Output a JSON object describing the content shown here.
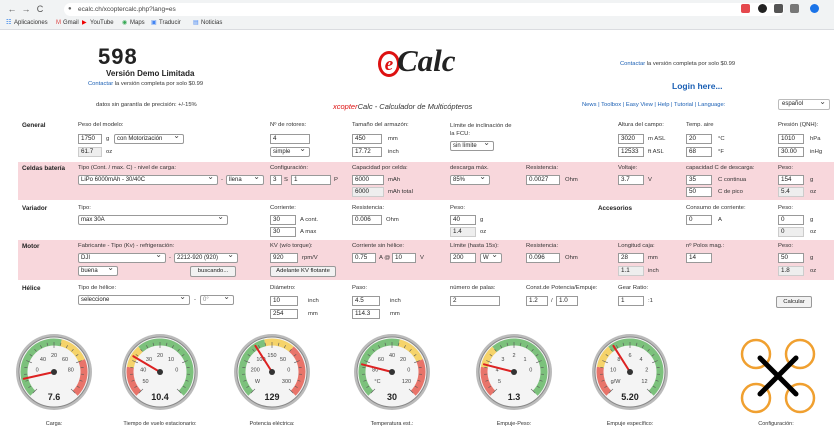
{
  "browser": {
    "url": "ecalc.ch/xcoptercalc.php?lang=es",
    "back": "←",
    "forward": "→",
    "reload": "C",
    "lock": "🔒",
    "bookmarks": [
      "Aplicaciones",
      "Gmail",
      "YouTube",
      "Maps",
      "Traducir",
      "Noticias"
    ]
  },
  "header": {
    "logo": "598",
    "version_title": "Versión Demo Limitada",
    "contact_link": "Contactar",
    "contact_rest": " la versión completa por solo $0.99",
    "no_warranty": "datos sin garantía de precisión: +/-15%",
    "ecalc_e": "e",
    "ecalc_rest": "Calc",
    "site_prefix": "xcopter",
    "site_title": "Calc - Calculador de Multicópteros",
    "full_version_link": "Contactar",
    "full_version_rest": " la versión completa por solo $0.99",
    "login": "Login here...",
    "nav": "News | Toolbox | Easy View | Help | Tutorial | Language:",
    "language": "español"
  },
  "general": {
    "label": "General",
    "model_weight_label": "Peso del modelo:",
    "model_weight": "1750",
    "g": "g",
    "weight_mode": "con Motorización",
    "oz_val": "61.7",
    "oz": "oz",
    "rotors_label": "Nº de rotores:",
    "rotors": "4",
    "frame_type": "simple",
    "frame_size_label": "Tamaño del armazón:",
    "frame_mm": "450",
    "mm": "mm",
    "frame_inch": "17.72",
    "inch": "inch",
    "fcu_limit_label": "Límite de inclinación de la FCU:",
    "fcu_limit": "sin límite",
    "field_alt_label": "Altura del campo:",
    "alt_m": "3020",
    "m_asl": "m ASL",
    "alt_ft": "12533",
    "ft_asl": "ft ASL",
    "temp_label": "Temp. aire",
    "temp_c": "20",
    "deg_c": "°C",
    "temp_f": "68",
    "deg_f": "°F",
    "pressure_label": "Presión (QNH):",
    "pressure_hpa": "1010",
    "hpa": "hPa",
    "pressure_inhg": "30.00",
    "inhg": "inHg"
  },
  "battery": {
    "label": "Celdas batería",
    "type_label": "Tipo (Cont. / max. C) - nivel de carga:",
    "type": "LiPo 6000mAh - 30/40C",
    "level": "llena",
    "config_label": "Configuración:",
    "s": "3",
    "s_unit": "S",
    "p": "1",
    "p_unit": "P",
    "capacity_label": "Capacidad por celda:",
    "cap_cell": "6000",
    "mah": "mAh",
    "cap_total": "6000",
    "mah_total": "mAh total",
    "discharge_label": "descarga máx.",
    "discharge": "85%",
    "resistance_label": "Resistencia:",
    "resistance": "0.0027",
    "ohm": "Ohm",
    "voltage_label": "Voltaje:",
    "voltage": "3.7",
    "v": "V",
    "c_rate_label": "capacidad C de descarga:",
    "c_cont": "35",
    "c_cont_unit": "C continua",
    "c_peak": "50",
    "c_peak_unit": "C de pico",
    "weight_label": "Peso:",
    "weight_g": "154",
    "weight_oz": "5.4"
  },
  "esc": {
    "label": "Variador",
    "type_label": "Tipo:",
    "type": "max 30A",
    "current_label": "Corriente:",
    "cont": "30",
    "a_cont": "A cont.",
    "max": "30",
    "a_max": "A max",
    "resistance_label": "Resistencia:",
    "resistance": "0.006",
    "ohm": "Ohm",
    "weight_label": "Peso:",
    "weight_g": "40",
    "weight_oz": "1.4",
    "accessories_label": "Accesorios",
    "acc_current_label": "Consumo de corriente:",
    "acc_current": "0",
    "a": "A",
    "acc_weight_label": "Peso:",
    "acc_weight_g": "0",
    "acc_weight_oz": "0"
  },
  "motor": {
    "label": "Motor",
    "manu_label": "Fabricante - Tipo (Kv) - refrigeración:",
    "manufacturer": "DJI",
    "type": "2212-920 (920)",
    "cooling": "buena",
    "search_btn": "buscando...",
    "kv_label": "KV (w/o torque):",
    "kv": "920",
    "rpm_v": "rpm/V",
    "kv_btn": "Adelante KV flotante",
    "no_load_label": "Corriente sin hélice:",
    "no_load": "0.75",
    "at_label": "A @",
    "no_load_v": "10",
    "v": "V",
    "limit_label": "Límite (hasta 15s):",
    "limit": "200",
    "limit_unit": "W",
    "resistance_label": "Resistencia:",
    "resistance": "0.096",
    "ohm": "Ohm",
    "case_len_label": "Longitud caja:",
    "case_mm": "28",
    "mm": "mm",
    "case_inch": "1.1",
    "inch": "inch",
    "poles_label": "nº Polos mag.:",
    "poles": "14",
    "weight_label": "Peso:",
    "weight_g": "50",
    "weight_oz": "1.8"
  },
  "propeller": {
    "label": "Hélice",
    "type_label": "Tipo de hélice:",
    "type": "seleccione",
    "angle": "0°",
    "diameter_label": "Diámetro:",
    "diam_inch": "10",
    "inch": "inch",
    "diam_mm": "254",
    "mm": "mm",
    "pitch_label": "Paso:",
    "pitch_inch": "4.5",
    "pitch_mm": "114.3",
    "blades_label": "número de palas:",
    "blades": "2",
    "const_label": "Const.de Potencia/Empuje:",
    "const_a": "1.2",
    "const_b": "1.0",
    "gear_label": "Gear Ratio:",
    "gear": "1",
    "gear_unit": ":1",
    "calc_btn": "Calcular"
  },
  "gauges": [
    {
      "caption": "Carga:",
      "value": "7.6",
      "ticks": [
        "20",
        "40",
        "60",
        "0",
        "80"
      ],
      "unit": "C",
      "needle": 0.12
    },
    {
      "caption": "Tiempo de vuelo estacionario:",
      "value": "10.4",
      "ticks": [
        "20",
        "30",
        "10",
        "40",
        "0",
        "50"
      ],
      "unit": "min",
      "needle": 0.28
    },
    {
      "caption": "Potencia eléctrica:",
      "value": "129",
      "ticks": [
        "150",
        "100",
        "50",
        "200",
        "0",
        "W",
        "300"
      ],
      "unit": "W",
      "needle": 0.38
    },
    {
      "caption": "Temperatura est.:",
      "value": "30",
      "ticks": [
        "40",
        "60",
        "20",
        "80",
        "0",
        "°C",
        "120"
      ],
      "unit": "°C",
      "needle": 0.22
    },
    {
      "caption": "Empuje-Peso:",
      "value": "1.3",
      "ticks": [
        "2",
        "3",
        "1",
        "4",
        "0",
        "5"
      ],
      "unit": "",
      "needle": 0.22
    },
    {
      "caption": "Empuje específico:",
      "value": "5.20",
      "ticks": [
        "6",
        "8",
        "4",
        "10",
        "2",
        "g/W",
        "12"
      ],
      "unit": "g/W",
      "needle": 0.38
    }
  ],
  "config_caption": "Configuración:",
  "colors": {
    "pink": "#f8d7dc",
    "link": "#1a5fb4",
    "red": "#d11"
  }
}
